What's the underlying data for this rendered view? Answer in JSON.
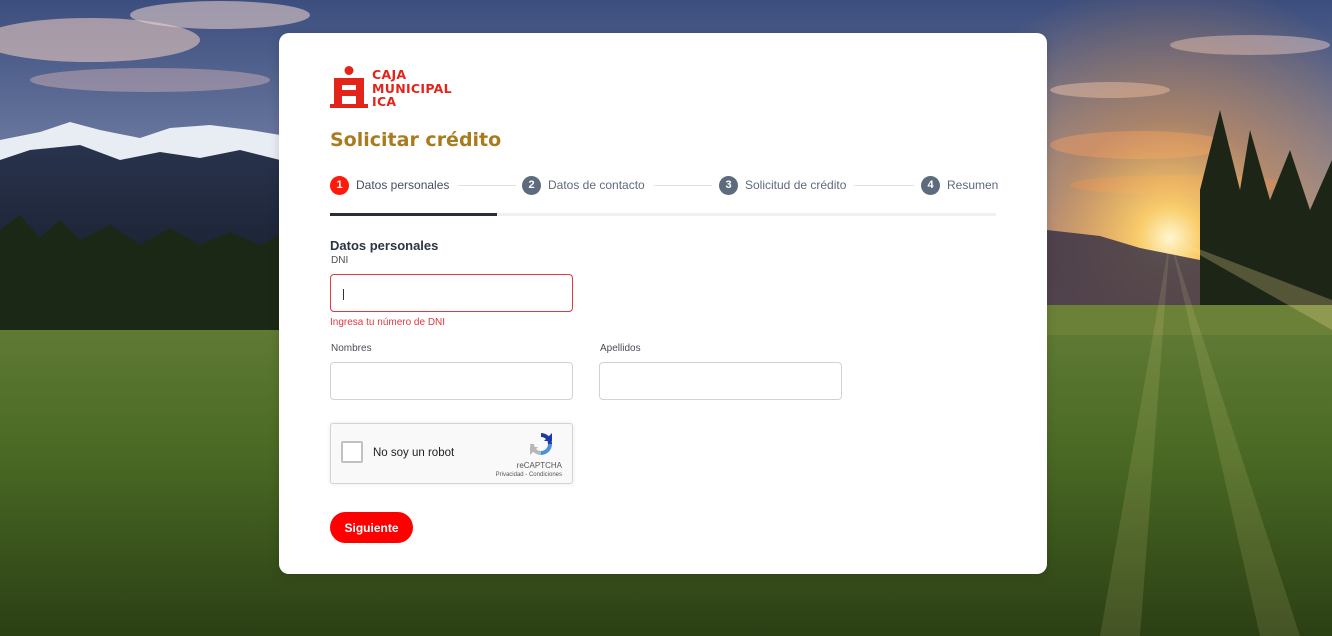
{
  "brand": {
    "name_lines": [
      "CAJA",
      "MUNICIPAL",
      "ICA"
    ],
    "color": "#e3241b"
  },
  "page": {
    "title": "Solicitar crédito",
    "title_color": "#a87b1e"
  },
  "stepper": {
    "active_step": 1,
    "active_color": "#ff1a0b",
    "inactive_color": "#5e6b7c",
    "steps": [
      {
        "number": "1",
        "label": "Datos personales"
      },
      {
        "number": "2",
        "label": "Datos de contacto"
      },
      {
        "number": "3",
        "label": "Solicitud de crédito"
      },
      {
        "number": "4",
        "label": "Resumen"
      }
    ]
  },
  "form": {
    "section_title": "Datos personales",
    "dni": {
      "label": "DNI",
      "value": "",
      "error": "Ingresa tu número de DNI"
    },
    "nombres": {
      "label": "Nombres",
      "value": ""
    },
    "apellidos": {
      "label": "Apellidos",
      "value": ""
    },
    "captcha": {
      "label": "No soy un robot",
      "brand": "reCAPTCHA",
      "links": "Privacidad - Condiciones",
      "checked": false
    },
    "submit_label": "Siguiente"
  },
  "colors": {
    "button": "#ff0000",
    "error": "#e0383e"
  }
}
